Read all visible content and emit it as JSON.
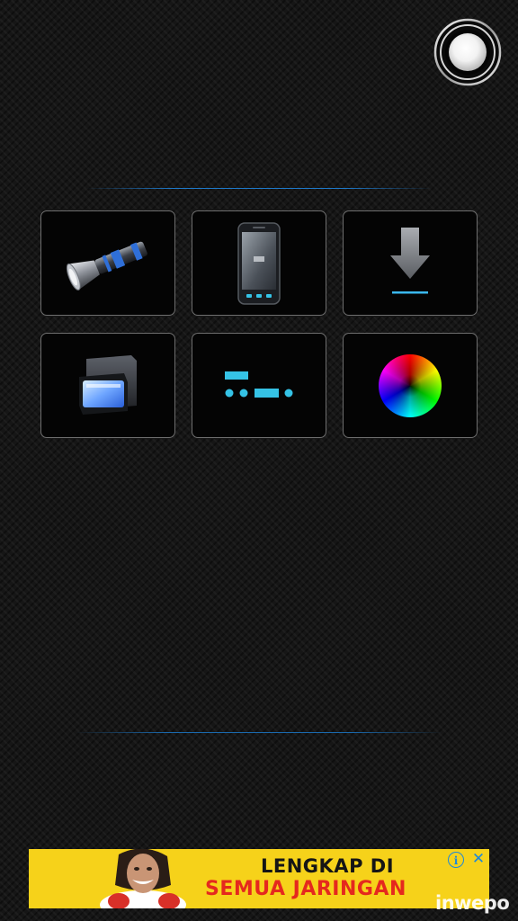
{
  "power_button": {
    "icon": "power-light-icon"
  },
  "tiles": [
    {
      "icon": "flashlight-icon"
    },
    {
      "icon": "phone-screen-light-icon"
    },
    {
      "icon": "download-arrow-icon"
    },
    {
      "icon": "camera-flash-icon"
    },
    {
      "icon": "morse-code-icon"
    },
    {
      "icon": "color-wheel-icon"
    }
  ],
  "ad": {
    "line1": "LENGKAP DI",
    "line2": "SEMUA JARINGAN",
    "info_symbol": "i",
    "close_symbol": "✕"
  },
  "watermark": "inwepo",
  "colors": {
    "accent": "#35c3e6",
    "divider": "#1e78c8",
    "ad_background": "#f6d21a",
    "ad_headline": "#151515",
    "ad_highlight": "#e5281e"
  }
}
